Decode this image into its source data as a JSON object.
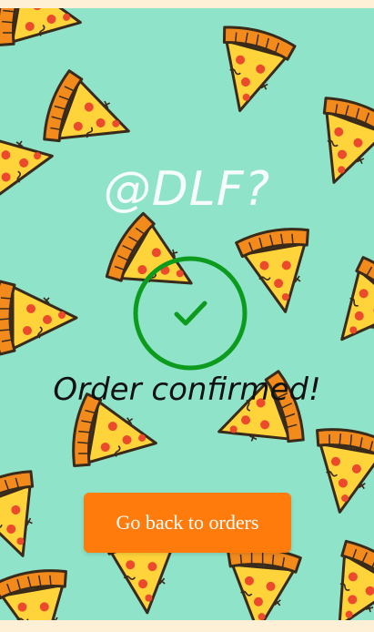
{
  "screen": {
    "brand_title": "@DLF?",
    "status_message": "Order confirmed!",
    "back_button_label": "Go back to orders"
  },
  "icons": {
    "success": "check-circle-icon",
    "background_pattern": "pizza-slice-icon"
  },
  "colors": {
    "background": "#8ee3c8",
    "frame": "#fdf0d6",
    "success_green": "#0c9b1d",
    "button": "#ff7b0c",
    "button_text": "#ffffff",
    "pizza_cheese": "#ffd43a",
    "pizza_crust": "#f28a1c",
    "pepperoni": "#ec4a2d"
  }
}
